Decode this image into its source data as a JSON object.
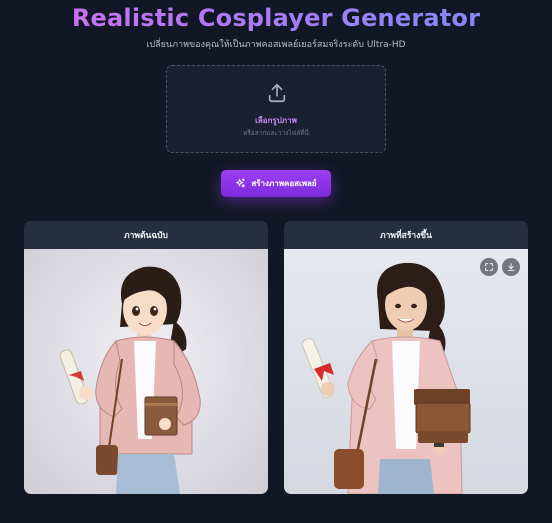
{
  "header": {
    "title": "Realistic Cosplayer Generator",
    "subtitle": "เปลี่ยนภาพของคุณให้เป็นภาพคอสเพลย์เยอร์สมจริงระดับ Ultra-HD"
  },
  "upload": {
    "label": "เลือกรูปภาพ",
    "hint": "หรือลากและวางไฟล์ที่นี่",
    "icon": "upload-icon"
  },
  "generate_button": {
    "label": "สร้างภาพคอสเพลย์",
    "icon": "sparkles-icon"
  },
  "panels": {
    "original": {
      "title": "ภาพต้นฉบับ"
    },
    "result": {
      "title": "ภาพที่สร้างขึ้น",
      "actions": [
        "expand-icon",
        "download-icon"
      ]
    }
  },
  "colors": {
    "background": "#121725",
    "accent": "#8b35e8",
    "title_gradient": [
      "#d46cf0",
      "#7b8cf8"
    ]
  }
}
